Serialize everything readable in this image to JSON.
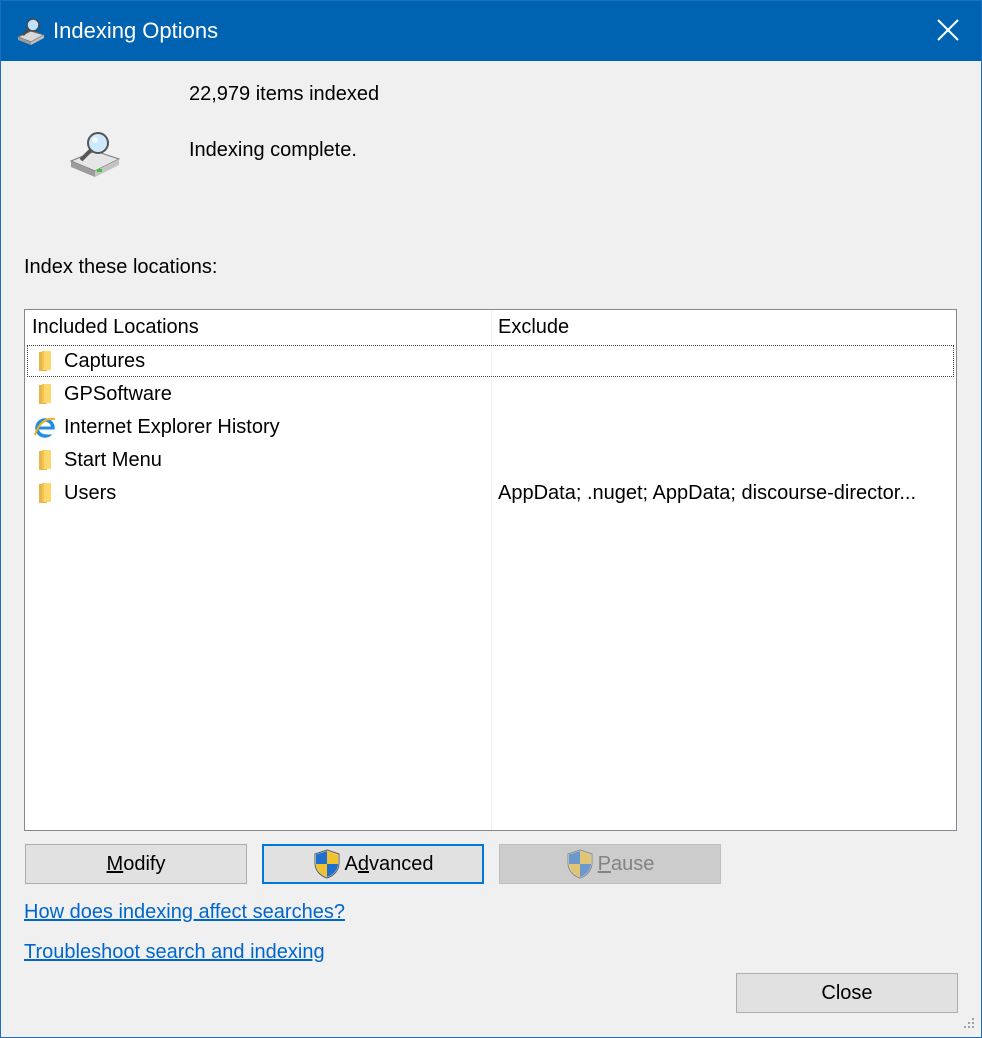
{
  "window": {
    "title": "Indexing Options",
    "title_icon": "indexing-options-icon",
    "close_icon": "close-icon",
    "titlebar_color": "#0063b1"
  },
  "status": {
    "count_text": "22,979 items indexed",
    "message": "Indexing complete.",
    "icon": "indexing-drive-icon"
  },
  "locations": {
    "label": "Index these locations:",
    "columns": {
      "included": "Included Locations",
      "exclude": "Exclude"
    },
    "rows": [
      {
        "icon": "folder-icon",
        "name": "Captures",
        "exclude": ""
      },
      {
        "icon": "folder-icon",
        "name": "GPSoftware",
        "exclude": ""
      },
      {
        "icon": "internet-explorer-icon",
        "name": "Internet Explorer History",
        "exclude": ""
      },
      {
        "icon": "folder-icon",
        "name": "Start Menu",
        "exclude": ""
      },
      {
        "icon": "folder-icon",
        "name": "Users",
        "exclude": "AppData; .nuget; AppData; discourse-director..."
      }
    ]
  },
  "buttons": {
    "modify": {
      "pre": "",
      "key": "M",
      "post": "odify"
    },
    "advanced": {
      "pre": "A",
      "key": "d",
      "post": "vanced",
      "icon": "uac-shield-icon"
    },
    "pause": {
      "pre": "",
      "key": "P",
      "post": "ause",
      "icon": "uac-shield-icon",
      "disabled": true
    },
    "close": "Close"
  },
  "links": {
    "how_indexing": "How does indexing affect searches?",
    "troubleshoot": "Troubleshoot search and indexing"
  },
  "colors": {
    "link": "#0066cc",
    "default_button_border": "#0078d7"
  }
}
